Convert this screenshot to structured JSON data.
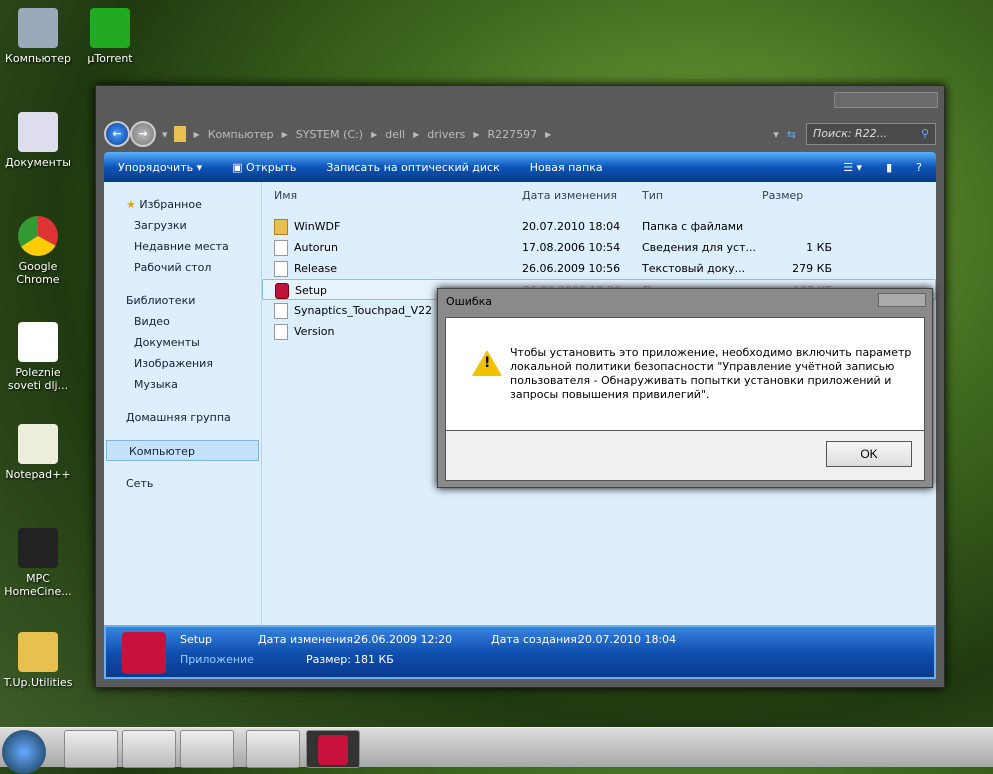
{
  "desktop": {
    "icons": [
      "Компьютер",
      "µTorrent",
      "Документы",
      "Google Chrome",
      "Poleznie soveti dlj...",
      "Notepad++",
      "MPC HomeCine...",
      "T.Up.Utilities"
    ]
  },
  "explorer": {
    "breadcrumb": [
      "Компьютер",
      "SYSTEM (C:)",
      "dell",
      "drivers",
      "R227597"
    ],
    "search_placeholder": "Поиск: R22...",
    "toolbar": {
      "organize": "Упорядочить",
      "open": "Открыть",
      "burn": "Записать на оптический диск",
      "new_folder": "Новая папка"
    },
    "nav": {
      "favorites": "Избранное",
      "downloads": "Загрузки",
      "recent": "Недавние места",
      "desktop": "Рабочий стол",
      "libraries": "Библиотеки",
      "video": "Видео",
      "documents": "Документы",
      "images": "Изображения",
      "music": "Музыка",
      "homegroup": "Домашняя группа",
      "computer": "Компьютер",
      "network": "Сеть"
    },
    "columns": {
      "name": "Имя",
      "date": "Дата изменения",
      "type": "Тип",
      "size": "Размер"
    },
    "files": [
      {
        "name": "WinWDF",
        "date": "20.07.2010 18:04",
        "type": "Папка с файлами",
        "size": "",
        "icon": "folder"
      },
      {
        "name": "Autorun",
        "date": "17.08.2006 10:54",
        "type": "Сведения для уст...",
        "size": "1 КБ",
        "icon": "file"
      },
      {
        "name": "Release",
        "date": "26.06.2009 10:56",
        "type": "Текстовый доку...",
        "size": "279 КБ",
        "icon": "file"
      },
      {
        "name": "Setup",
        "date": "26.06.2009 12:20",
        "type": "Приложение",
        "size": "182 КБ",
        "icon": "app"
      },
      {
        "name": "Synaptics_Touchpad_V22",
        "date": "",
        "type": "",
        "size": "",
        "icon": "file"
      },
      {
        "name": "Version",
        "date": "",
        "type": "",
        "size": "",
        "icon": "file"
      }
    ],
    "details": {
      "name": "Setup",
      "type": "Приложение",
      "modified_label": "Дата изменения:",
      "modified": "26.06.2009 12:20",
      "created_label": "Дата создания:",
      "created": "20.07.2010 18:04",
      "size_label": "Размер:",
      "size": "181 КБ"
    }
  },
  "dialog": {
    "title": "Ошибка",
    "message": "Чтобы установить это приложение, необходимо включить параметр локальной политики безопасности \"Управление учётной записью пользователя - Обнаруживать попытки установки приложений и запросы повышения привилегий\".",
    "ok": "OK"
  }
}
